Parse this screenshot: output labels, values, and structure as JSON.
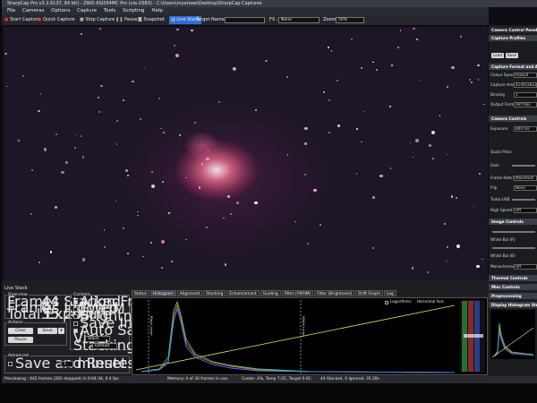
{
  "app": {
    "title": "SharpCap Pro v3.2.6137, 64 bit) - ZWO ASI294MC Pro (via USB3) - C:\\Users\\myatsaw\\Desktop\\SharpCap Captures"
  },
  "menu": [
    "File",
    "Cameras",
    "Options",
    "Capture",
    "Tools",
    "Scripting",
    "Help"
  ],
  "toolbar": {
    "start_capture": "Start Capture",
    "quick_capture": "Quick Capture",
    "stop_capture": "Stop Capture",
    "pause": "Pause",
    "snapshot": "Snapshot",
    "live_stack": "Live Stack",
    "target_name_label": "Target Name :",
    "target_name_value": "",
    "fx_label": "FX :",
    "fx_value": "None",
    "zoom_label": "Zoom:",
    "zoom_value": "50%"
  },
  "right_panel": {
    "title": "Camera Control Panel",
    "capture_profiles": "Capture Profiles",
    "load": "Load",
    "save": "Save",
    "capture_format_area": "Capture Format and Area",
    "color_space_label": "Colour Space",
    "color_space_value": "RGB24",
    "capture_area_label": "Capture Area",
    "capture_area_value": "4144x2822",
    "binning_label": "Binning",
    "binning_value": "1",
    "output_format_label": "Output Format",
    "output_format_value": "AVI files",
    "camera_controls": "Camera Controls",
    "exposure_label": "Exposure",
    "exposure_value": "800 ms",
    "quick_picks": "Quick Picks",
    "gain_label": "Gain",
    "frame_rate_label": "Frame Rate Limit",
    "frame_rate_value": "Maximum",
    "flip_label": "Flip",
    "flip_value": "None",
    "turbo_usb_label": "Turbo USB",
    "high_speed_label": "High Speed Mode",
    "high_speed_value": "Off",
    "image_controls": "Image Controls",
    "white_bal_r_label": "White Bal (R)",
    "white_bal_b_label": "White Bal (B)",
    "monochrome_label": "Monochrome",
    "monochrome_value": "Off",
    "thermal_controls": "Thermal Controls",
    "misc_controls": "Misc Controls",
    "preprocessing": "Preprocessing",
    "display_histogram": "Display Histogram Stretch"
  },
  "live_stack": {
    "title": "Live Stack",
    "overview": "Overview",
    "frames_stacked_label": "Frames Stacked",
    "frames_stacked_value": "44",
    "frames_ignored_label": "Frames Ignored",
    "frames_ignored_value": "0",
    "total_exposure_label": "Total Exposure",
    "total_exposure_value": "35.20s",
    "actions": "Actions",
    "clear": "Clear",
    "save": "Save",
    "pause": "Pause",
    "advanced": "Advanced",
    "save_reset_label": "Save and Reset every",
    "save_reset_value": "1",
    "minutes_label": "minutes total exposure",
    "controls": "Controls",
    "align_frames": "Align Frames",
    "fwhm_filter": "FWHM Filter",
    "brightness_filter": "Brightness Filter",
    "save_individual": "Save Individual Frames",
    "auto_save": "Auto Save on Clear/Close",
    "view_label": "View",
    "view_value": "Stack",
    "stacking_label": "Stacking",
    "stacking_value": "Default"
  },
  "tabs": [
    "Status",
    "Histogram",
    "Alignment",
    "Stacking",
    "Enhancement",
    "Guiding",
    "Filter (FWHM)",
    "Filter (Brightness)",
    "Drift Graph",
    "Log"
  ],
  "histogram": {
    "log_label": "Logarithmic",
    "horizontal_axis_label": "Horizontal Axis",
    "black_level_label": "Black Level",
    "white_level_label": "White Level"
  },
  "status": {
    "previewing": "Previewing : 442 frames (262 dropped) in 0:04:34, 0.4 fps",
    "memory": "Memory: 4 of 30 frames in use.",
    "cooler": "Cooler: 4%, Temp 7.0C, Target 0.0C",
    "stacked": "44 Stacked, 0 Ignored, 35.20s"
  }
}
